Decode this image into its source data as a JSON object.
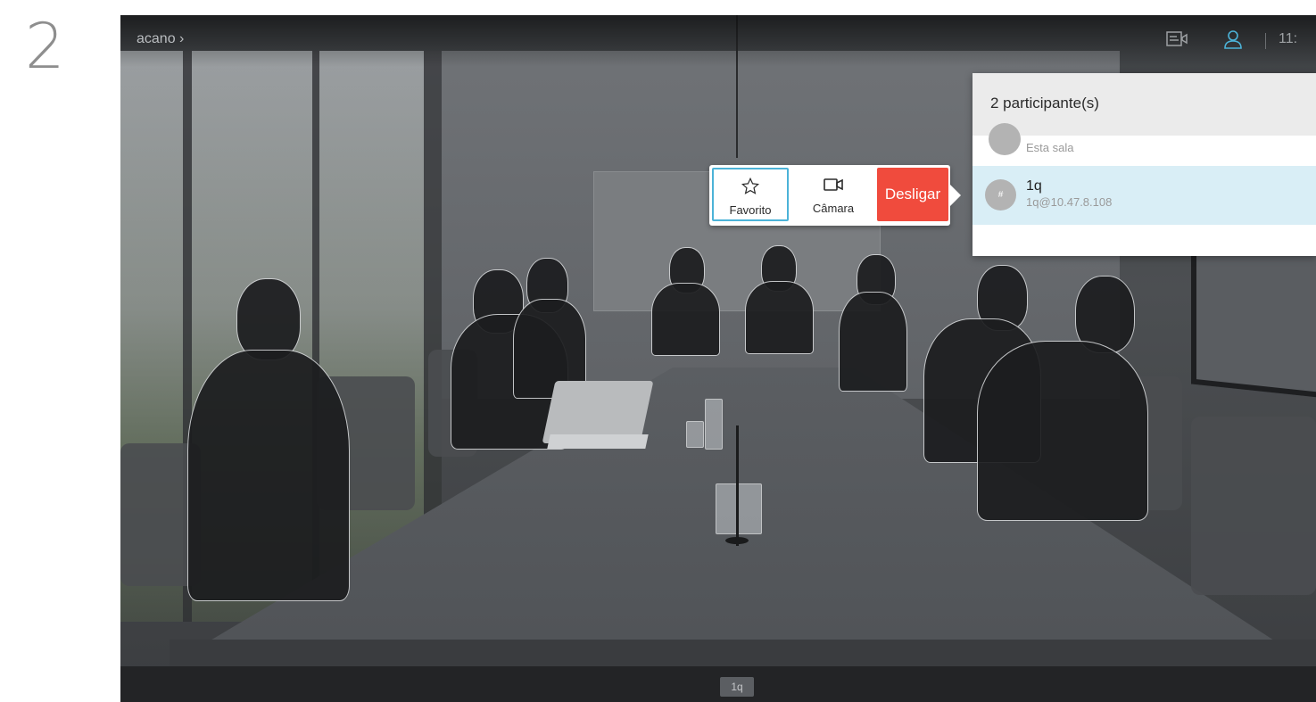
{
  "step_number": "2",
  "topbar": {
    "call_name": "acano",
    "call_name_chevron": "›",
    "clock": "11:",
    "icons": [
      "layout-icon",
      "participants-icon"
    ]
  },
  "participants_panel": {
    "title": "2 participante(s)",
    "rows": [
      {
        "avatar": "",
        "name": "",
        "subtitle": "Esta sala"
      },
      {
        "avatar": "#",
        "name": "1q",
        "subtitle": "1q@10.47.8.108",
        "selected": true
      }
    ]
  },
  "actions": {
    "favorite_label": "Favorito",
    "camera_label": "Câmara",
    "hangup_label": "Desligar"
  },
  "bottom_tag": "1q",
  "colors": {
    "accent": "#4cb3d8",
    "hangup": "#f04b3d",
    "selected_row": "#d9eef6"
  }
}
